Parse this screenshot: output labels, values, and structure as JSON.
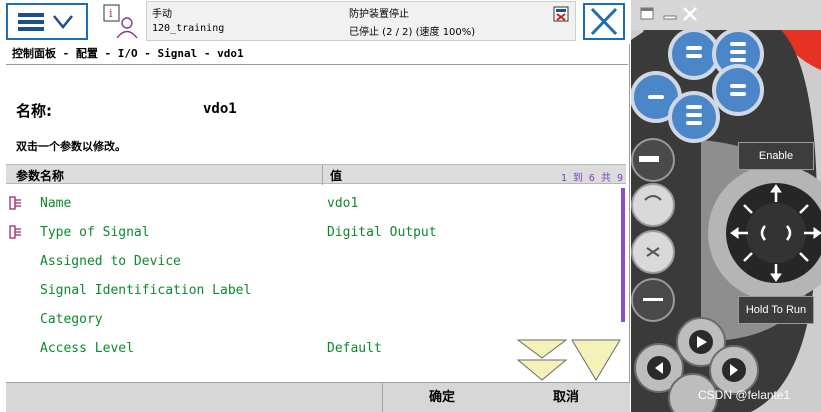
{
  "status": {
    "mode": "手动",
    "robot_name": "120_training",
    "safety": "防护装置停止",
    "state": "已停止 (2 / 2) (速度 100%)"
  },
  "breadcrumb": "控制面板 - 配置 - I/O - Signal - vdo1",
  "name_label": "名称:",
  "name_value": "vdo1",
  "instruction": "双击一个参数以修改。",
  "table": {
    "col_name": "参数名称",
    "col_value": "值",
    "page_info": "1 到 6 共 9",
    "rows": [
      {
        "name": "Name",
        "value": "vdo1",
        "has_icon": true
      },
      {
        "name": "Type of Signal",
        "value": "Digital Output",
        "has_icon": true
      },
      {
        "name": "Assigned to Device",
        "value": "",
        "has_icon": false
      },
      {
        "name": "Signal Identification Label",
        "value": "",
        "has_icon": false
      },
      {
        "name": "Category",
        "value": "",
        "has_icon": false
      },
      {
        "name": "Access Level",
        "value": "Default",
        "has_icon": false
      }
    ]
  },
  "buttons": {
    "ok": "确定",
    "cancel": "取消"
  },
  "panel": {
    "enable_label": "Enable",
    "hold_label": "Hold To Run"
  },
  "watermark": "CSDN @felante1",
  "colors": {
    "param_green": "#0c8a2c",
    "accent_blue": "#1f6fb0",
    "page_info_purple": "#7a3fbf",
    "panel_dark": "#3d3d3d",
    "panel_blue": "#4a86c8"
  }
}
